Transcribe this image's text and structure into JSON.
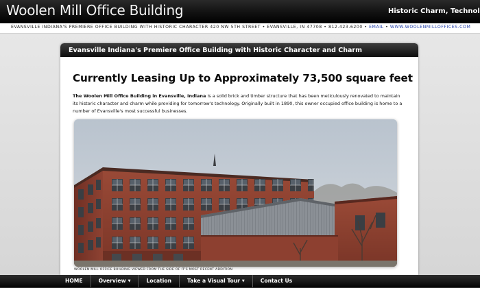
{
  "header": {
    "site_title": "Woolen Mill Office Building",
    "tagline": "Historic Charm, Technological Savv"
  },
  "info_strip": {
    "text": "EVANSVILLE INDIANA'S PREMIERE OFFICE BUILDING WITH HISTORIC CHARACTER 420 NW 5TH STREET • EVANSVILLE, IN 47708 • 812.423.6200 • ",
    "email_label": "EMAIL",
    "separator": " • ",
    "website_label": "WWW.WOOLENMILLOFFICES.COM"
  },
  "panel": {
    "title": "Evansville Indiana's Premiere Office Building with Historic Character and Charm",
    "headline": "Currently Leasing Up to Approximately 73,500 square feet",
    "intro_bold": "The Woolen Mill Office Building in Evansville, Indiana",
    "intro_text": " is a solid brick and timber structure that has been meticulously renovated to maintain its historic character and charm while providing for tomorrow's technology. Originally built in 1890, this owner occupied office building is home to a number of Evansville's most successful businesses.",
    "photo_caption": "WOOLEN MILL OFFICE BUILDING VIEWED FROM THE SIDE OF IT'S MOST RECENT ADDITION"
  },
  "nav": {
    "items": [
      {
        "label": "HOME",
        "dropdown": false
      },
      {
        "label": "Overview",
        "dropdown": true
      },
      {
        "label": "Location",
        "dropdown": false
      },
      {
        "label": "Take a Visual Tour",
        "dropdown": true
      },
      {
        "label": "Contact Us",
        "dropdown": false
      }
    ]
  },
  "colors": {
    "header_bg": "#000000",
    "panel_header_bg": "#1a1a1a",
    "link": "#1d3aa8",
    "brick": "#8a3b2c",
    "sky": "#c3ccd6"
  }
}
